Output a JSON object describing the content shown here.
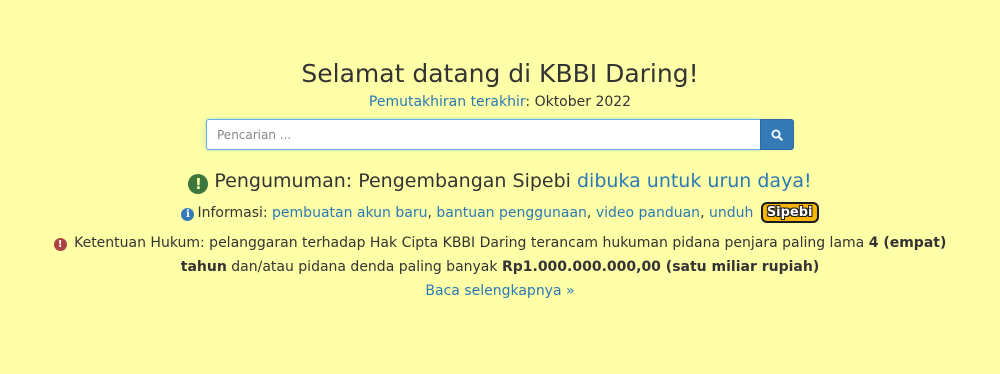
{
  "header": {
    "title": "Selamat datang di KBBI Daring!",
    "updated_link": "Pemutakhiran terakhir",
    "updated_sep": ":",
    "updated_value": "Oktober 2022"
  },
  "search": {
    "placeholder": "Pencarian ...",
    "button_icon": "search-icon"
  },
  "announcement": {
    "icon": "exclamation-circle-icon",
    "prefix": "Pengumuman: Pengembangan Sipebi",
    "link": "dibuka untuk urun daya!",
    "icon_color": "#3c763d"
  },
  "info": {
    "icon": "info-circle-icon",
    "label": "Informasi:",
    "links": [
      "pembuatan akun baru",
      "bantuan penggunaan",
      "video panduan",
      "unduh"
    ],
    "separator": ",",
    "badge": "Sipebi"
  },
  "legal": {
    "icon": "exclamation-circle-icon",
    "text_1": "Ketentuan Hukum: pelanggaran terhadap Hak Cipta KBBI Daring terancam hukuman pidana penjara paling lama",
    "bold_1": "4 (empat) tahun",
    "text_2": "dan/atau pidana denda paling banyak",
    "bold_2": "Rp1.000.000.000,00 (satu miliar rupiah)",
    "read_more": "Baca selengkapnya »",
    "icon_color": "#a94442"
  },
  "colors": {
    "background": "#ffffa8",
    "link": "#2a7ab8",
    "primary_button": "#337ab7"
  }
}
